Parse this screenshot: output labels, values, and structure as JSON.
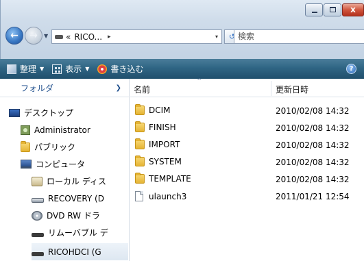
{
  "window": {
    "controls": {
      "minimize": "",
      "maximize": "",
      "close": "x"
    }
  },
  "address_bar": {
    "crumb_prefix": "«",
    "path_text": "RICO...",
    "separator": "▸",
    "dropdown": "▾",
    "refresh_glyph": "↺",
    "search_placeholder": "検索"
  },
  "toolbar": {
    "organize": "整理",
    "views": "表示",
    "burn": "書き込む",
    "help": "?"
  },
  "nav_pane": {
    "header": "フォルダ",
    "items": [
      {
        "label": "デスクトップ",
        "icon": "desktop-icon"
      },
      {
        "label": "Administrator",
        "icon": "user-folder-icon"
      },
      {
        "label": "パブリック",
        "icon": "folder-icon"
      },
      {
        "label": "コンピュータ",
        "icon": "computer-icon"
      },
      {
        "label": "ローカル ディス",
        "icon": "local-disk-icon"
      },
      {
        "label": "RECOVERY (D",
        "icon": "drive-icon"
      },
      {
        "label": "DVD RW ドラ",
        "icon": "dvd-drive-icon"
      },
      {
        "label": "リムーバブル デ",
        "icon": "removable-drive-icon"
      },
      {
        "label": "RICOHDCI (G",
        "icon": "removable-drive-icon"
      }
    ]
  },
  "content": {
    "columns": {
      "name": "名前",
      "modified": "更新日時"
    },
    "files": [
      {
        "name": "DCIM",
        "modified": "2010/02/08 14:32",
        "type": "folder"
      },
      {
        "name": "FINISH",
        "modified": "2010/02/08 14:32",
        "type": "folder"
      },
      {
        "name": "IMPORT",
        "modified": "2010/02/08 14:32",
        "type": "folder"
      },
      {
        "name": "SYSTEM",
        "modified": "2010/02/08 14:32",
        "type": "folder"
      },
      {
        "name": "TEMPLATE",
        "modified": "2010/02/08 14:32",
        "type": "folder"
      },
      {
        "name": "ulaunch3",
        "modified": "2011/01/21 12:54",
        "type": "file"
      }
    ]
  }
}
